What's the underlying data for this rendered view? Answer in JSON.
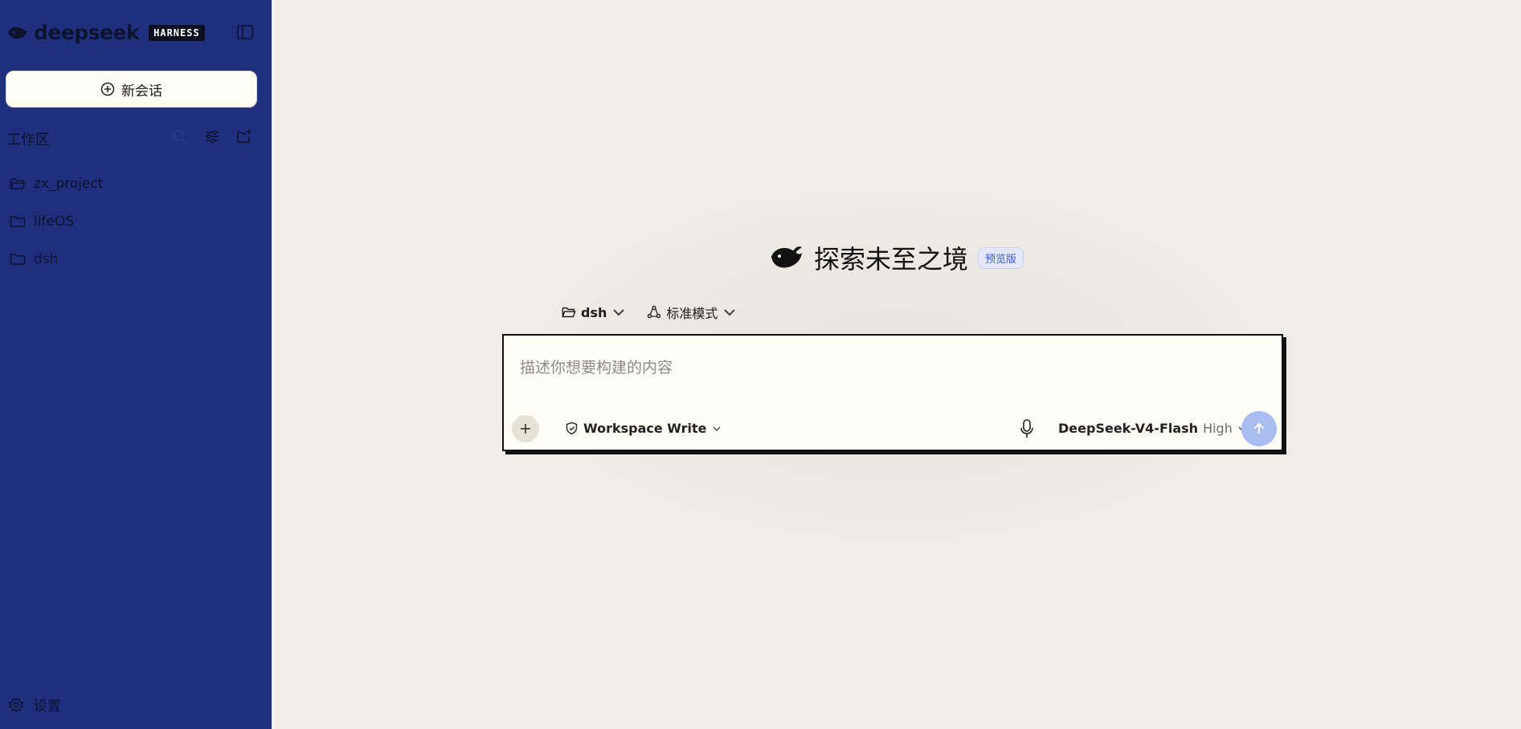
{
  "sidebar": {
    "brand": {
      "name": "deepseek",
      "badge": "HARNESS"
    },
    "new_chat_label": "新会话",
    "workspace_label": "工作区",
    "folders": [
      {
        "label": "zx_project",
        "icon": "folder-open-icon"
      },
      {
        "label": "lifeOS",
        "icon": "folder-icon"
      },
      {
        "label": "dsh",
        "icon": "folder-icon"
      }
    ],
    "settings_label": "设置"
  },
  "main": {
    "title": "探索未至之境",
    "preview_badge": "预览版",
    "folder_selector": "dsh",
    "mode_selector": "标准模式",
    "composer": {
      "placeholder": "描述你想要构建的内容",
      "permission": "Workspace Write",
      "model_name": "DeepSeek-V4-Flash",
      "model_level": "High"
    }
  },
  "colors": {
    "sidebar_bg": "#1f2f7d",
    "main_bg": "#f3efe8",
    "send_button": "#a9bdf3",
    "badge_text": "#3b5bd8"
  }
}
